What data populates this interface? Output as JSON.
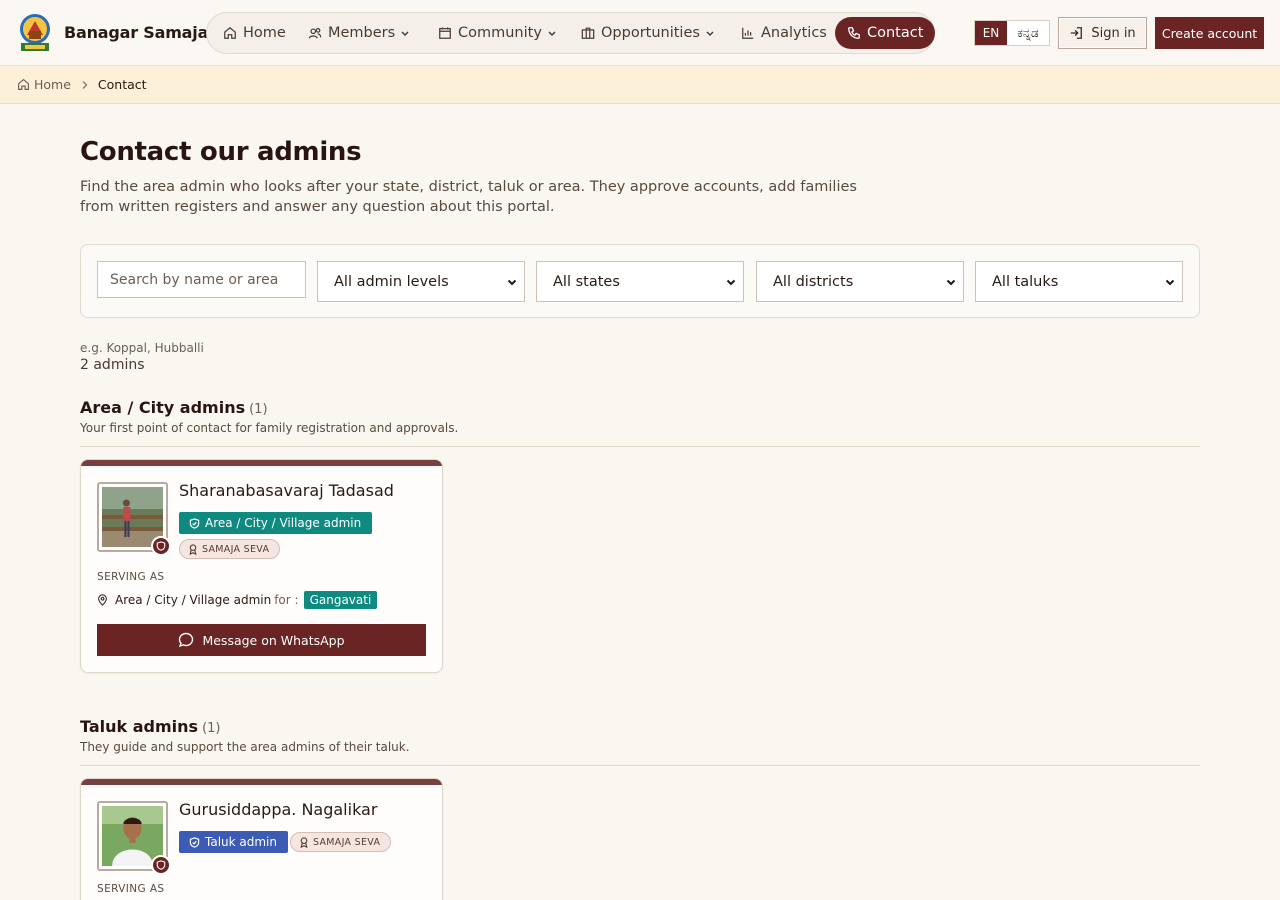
{
  "header": {
    "brand": "Banagar Samaja",
    "nav": [
      {
        "label": "Home"
      },
      {
        "label": "Members"
      },
      {
        "label": "Community"
      },
      {
        "label": "Opportunities"
      },
      {
        "label": "Analytics"
      },
      {
        "label": "Contact"
      }
    ],
    "lang_en": "EN",
    "lang_kn": "ಕನ್ನಡ",
    "sign_in": "Sign in",
    "create_account": "Create account"
  },
  "breadcrumb": {
    "home": "Home",
    "current": "Contact"
  },
  "page": {
    "title": "Contact our admins",
    "description": "Find the area admin who looks after your state, district, taluk or area. They approve accounts, add families from written registers and answer any question about this portal."
  },
  "filters": {
    "search_placeholder": "Search by name or area",
    "hint": "e.g. Koppal, Hubballi",
    "admin_level": "All admin levels",
    "state": "All states",
    "district": "All districts",
    "taluk": "All taluks"
  },
  "results": {
    "count": "2 admins"
  },
  "sections": [
    {
      "title": "Area / City admins",
      "count": "(1)",
      "subtitle": "Your first point of contact for family registration and approvals.",
      "admins": [
        {
          "name": "Sharanabasavaraj Tadasad",
          "role": "Area / City / Village admin",
          "badge": "SAMAJA SEVA",
          "serving_label": "SERVING AS",
          "serving_role": "Area / City / Village admin",
          "for_label": "for :",
          "location": "Gangavati",
          "whatsapp": "Message on WhatsApp"
        }
      ]
    },
    {
      "title": "Taluk admins",
      "count": "(1)",
      "subtitle": "They guide and support the area admins of their taluk.",
      "admins": [
        {
          "name": "Gurusiddappa. Nagalikar",
          "role": "Taluk admin",
          "badge": "SAMAJA SEVA",
          "serving_label": "SERVING AS"
        }
      ]
    }
  ],
  "colors": {
    "brand": "#6b2424",
    "area_badge": "#0f8a80",
    "taluk_badge": "#3b5bb5",
    "breadcrumb_bg": "#fdf0d8"
  }
}
